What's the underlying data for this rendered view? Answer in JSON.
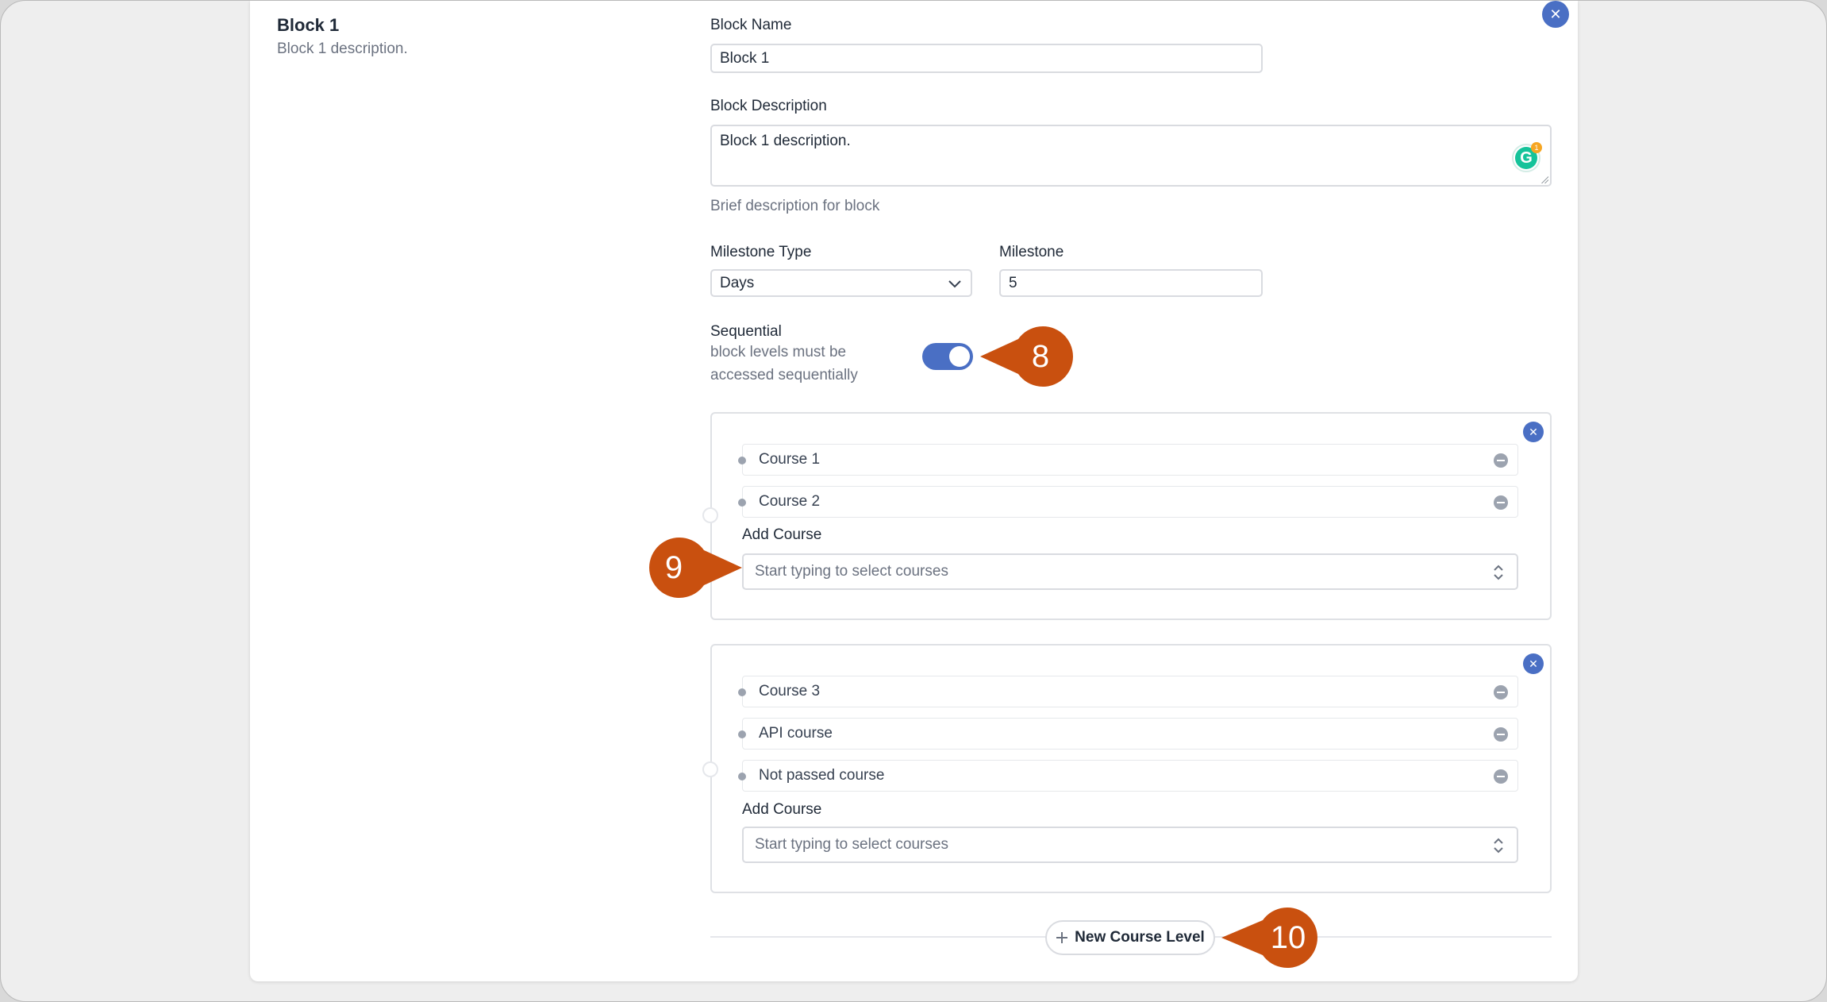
{
  "block": {
    "title": "Block 1",
    "description": "Block 1 description."
  },
  "form": {
    "name_label": "Block Name",
    "name_value": "Block 1",
    "description_label": "Block Description",
    "description_value": "Block 1 description.",
    "description_hint": "Brief description for block",
    "grammarly_badge_count": "1",
    "milestone_type_label": "Milestone Type",
    "milestone_type_value": "Days",
    "milestone_label": "Milestone",
    "milestone_value": "5",
    "sequential_label": "Sequential",
    "sequential_hint_line1": "block levels must be",
    "sequential_hint_line2": "accessed sequentially",
    "sequential_on": true
  },
  "levels": [
    {
      "courses": [
        "Course 1",
        "Course 2"
      ],
      "add_course_label": "Add Course",
      "add_course_placeholder": "Start typing to select courses"
    },
    {
      "courses": [
        "Course 3",
        "API course",
        "Not passed course"
      ],
      "add_course_label": "Add Course",
      "add_course_placeholder": "Start typing to select courses"
    }
  ],
  "new_level_button": "New Course Level",
  "callouts": {
    "c8": "8",
    "c9": "9",
    "c10": "10"
  },
  "colors": {
    "accent": "#4a6fc4",
    "callout": "#c9500f"
  }
}
